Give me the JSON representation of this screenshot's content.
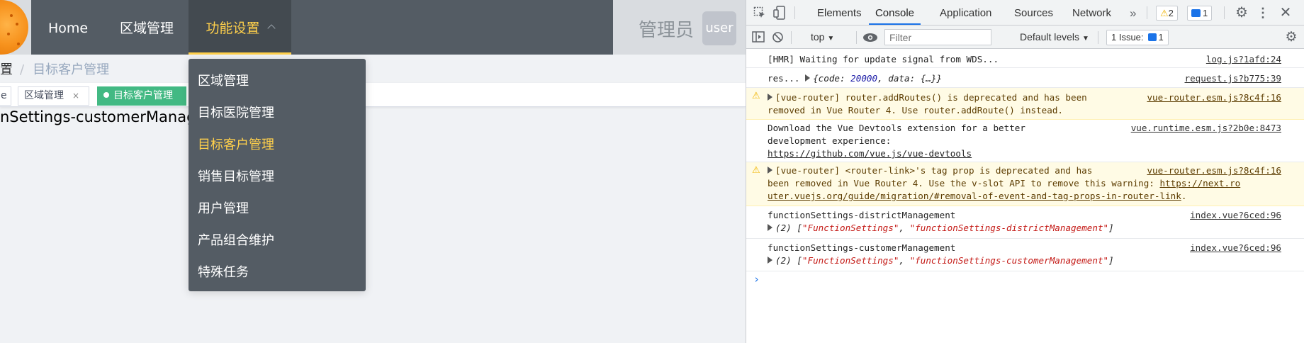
{
  "nav": {
    "home": "Home",
    "district": "区域管理",
    "settings": "功能设置",
    "admin": "管理员",
    "avatar": "user"
  },
  "breadcrumb": {
    "parent": "置",
    "current": "目标客户管理"
  },
  "tags": [
    {
      "label": "e"
    },
    {
      "label": "区域管理",
      "close": "×"
    },
    {
      "label": "目标客户管理"
    }
  ],
  "route_text": "nSettings-customerManage",
  "dropdown": {
    "items": [
      "区域管理",
      "目标医院管理",
      "目标客户管理",
      "销售目标管理",
      "用户管理",
      "产品组合维护",
      "特殊任务"
    ],
    "active_index": 2
  },
  "devtools": {
    "tabs": [
      "Elements",
      "Console",
      "Application",
      "Sources",
      "Network"
    ],
    "active_tab": "Console",
    "more": "»",
    "warn_count": "2",
    "info_count": "1",
    "toolbar": {
      "context": "top",
      "filter_placeholder": "Filter",
      "levels": "Default levels",
      "issues_label": "1 Issue:",
      "issues_count": "1"
    },
    "console": [
      {
        "text": "[HMR] Waiting for update signal from WDS...",
        "src": "log.js?1afd:24"
      },
      {
        "pre": "res...",
        "obj_a": "{code: ",
        "obj_num": "20000",
        "obj_b": ", data: {…}}",
        "src": "request.js?b775:39"
      },
      {
        "l1": "[vue-router] router.addRoutes() is deprecated and has been",
        "l2": "removed in Vue Router 4. Use router.addRoute() instead.",
        "src": "vue-router.esm.js?8c4f:16"
      },
      {
        "l1": "Download the Vue Devtools extension for a better",
        "l2": "development experience:",
        "l3": "https://github.com/vue.js/vue-devtools",
        "src": "vue.runtime.esm.js?2b0e:8473"
      },
      {
        "l1": "[vue-router] <router-link>'s tag prop is deprecated and has",
        "l2a": "been removed in Vue Router 4. Use the v-slot API to remove this warning: ",
        "l2b": "https://next.ro",
        "l3a": "uter.vuejs.org/guide/migration/#removal-of-event-and-tag-props-in-router-link",
        "l3b": ".",
        "src": "vue-router.esm.js?8c4f:16"
      },
      {
        "l1": "functionSettings-districtManagement",
        "count": "(2) [",
        "s1": "\"FunctionSettings\"",
        "comma": ", ",
        "s2": "\"functionSettings-districtManagement\"",
        "close": "]",
        "src": "index.vue?6ced:96"
      },
      {
        "l1": "functionSettings-customerManagement",
        "count": "(2) [",
        "s1": "\"FunctionSettings\"",
        "comma": ", ",
        "s2": "\"functionSettings-customerManagement\"",
        "close": "]",
        "src": "index.vue?6ced:96"
      }
    ],
    "prompt": "›"
  }
}
